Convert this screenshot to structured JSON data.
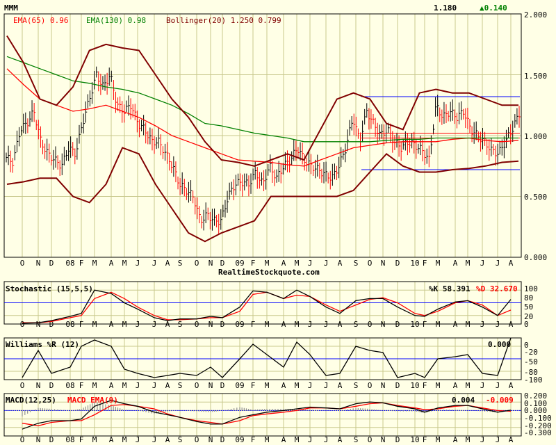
{
  "header": {
    "symbol": "MMM",
    "last_price": "1.180",
    "change": "▲0.140",
    "change_color": "#008000",
    "ema65_label": "EMA(65) 0.96",
    "ema130_label": "EMA(130) 0.98",
    "bollinger_label": "Bollinger(20) 1.250 0.799",
    "watermark": "RealtimeStockquote.com"
  },
  "colors": {
    "background": "#FFFFE6",
    "grid": "#C8C88C",
    "ema65": "#FF0000",
    "ema130": "#008000",
    "bollinger": "#800000",
    "reference": "#0000FF",
    "down_bar": "#FF0000",
    "up_bar": "#000000"
  },
  "months": [
    "O",
    "N",
    "D",
    "08",
    "F",
    "M",
    "A",
    "M",
    "J",
    "J",
    "A",
    "S",
    "O",
    "N",
    "D",
    "09",
    "F",
    "M",
    "A",
    "M",
    "J",
    "J",
    "A",
    "S",
    "O",
    "N",
    "D",
    "10",
    "F",
    "M",
    "A",
    "M",
    "J",
    "J",
    "A"
  ],
  "chart_data": [
    {
      "type": "line",
      "title": "MMM price",
      "ylabel": "",
      "ylim": [
        0,
        2
      ],
      "yticks": [
        "2.000",
        "1.500",
        "1.000",
        "0.500",
        "0.000"
      ],
      "close": [
        0.82,
        0.78,
        1.05,
        1.1,
        1.2,
        0.95,
        0.85,
        0.8,
        0.75,
        0.9,
        0.85,
        1.1,
        1.3,
        1.5,
        1.4,
        1.5,
        1.25,
        1.2,
        1.25,
        1.1,
        1.05,
        0.95,
        0.95,
        0.85,
        0.75,
        0.6,
        0.55,
        0.5,
        0.3,
        0.35,
        0.3,
        0.3,
        0.5,
        0.6,
        0.62,
        0.6,
        0.7,
        0.6,
        0.75,
        0.65,
        0.75,
        0.8,
        0.9,
        0.8,
        0.75,
        0.72,
        0.68,
        0.65,
        0.75,
        0.9,
        1.15,
        0.95,
        1.2,
        1.1,
        1.0,
        1.05,
        0.95,
        0.9,
        0.95,
        0.92,
        0.88,
        0.8,
        1.25,
        1.15,
        1.2,
        1.15,
        1.2,
        1.05,
        1.0,
        0.95,
        0.88,
        0.85,
        0.95,
        1.05,
        1.18
      ],
      "series": [
        {
          "name": "EMA(65)",
          "values": [
            1.55,
            1.42,
            1.3,
            1.25,
            1.2,
            1.22,
            1.25,
            1.2,
            1.15,
            1.08,
            1.0,
            0.95,
            0.9,
            0.85,
            0.8,
            0.79,
            0.78,
            0.76,
            0.75,
            0.8,
            0.85,
            0.9,
            0.92,
            0.94,
            0.95,
            0.95,
            0.95,
            0.97,
            0.98,
            0.96,
            0.95,
            0.96
          ]
        },
        {
          "name": "EMA(130)",
          "values": [
            1.65,
            1.6,
            1.55,
            1.5,
            1.45,
            1.43,
            1.4,
            1.38,
            1.35,
            1.3,
            1.25,
            1.18,
            1.1,
            1.08,
            1.05,
            1.02,
            1.0,
            0.98,
            0.95,
            0.95,
            0.95,
            0.95,
            0.95,
            0.96,
            0.97,
            0.97,
            0.98,
            0.98,
            0.98,
            0.98,
            0.98,
            0.98
          ]
        },
        {
          "name": "Bollinger Upper",
          "values": [
            1.82,
            1.6,
            1.3,
            1.25,
            1.4,
            1.7,
            1.75,
            1.72,
            1.7,
            1.5,
            1.3,
            1.15,
            0.95,
            0.8,
            0.78,
            0.75,
            0.8,
            0.85,
            0.8,
            1.05,
            1.3,
            1.35,
            1.3,
            1.1,
            1.05,
            1.35,
            1.38,
            1.35,
            1.35,
            1.3,
            1.25,
            1.25
          ]
        },
        {
          "name": "Bollinger Lower",
          "values": [
            0.6,
            0.62,
            0.65,
            0.65,
            0.5,
            0.45,
            0.6,
            0.9,
            0.85,
            0.6,
            0.4,
            0.2,
            0.13,
            0.2,
            0.25,
            0.3,
            0.5,
            0.5,
            0.5,
            0.5,
            0.5,
            0.55,
            0.7,
            0.85,
            0.75,
            0.7,
            0.7,
            0.72,
            0.73,
            0.75,
            0.78,
            0.79
          ]
        }
      ],
      "support_resistance": [
        1.32,
        1.02,
        0.98,
        0.72
      ]
    },
    {
      "type": "line",
      "title": "Stochastic (15,5,5)",
      "k_label": "%K 58.391",
      "d_label": "%D 32.670",
      "ylim": [
        0,
        100
      ],
      "yticks": [
        "100",
        "80",
        "50",
        "20",
        "0"
      ],
      "reference": 50,
      "series": [
        {
          "name": "%K",
          "values": [
            2,
            3,
            8,
            18,
            25,
            80,
            72,
            50,
            35,
            15,
            8,
            12,
            12,
            18,
            15,
            40,
            78,
            75,
            60,
            80,
            65,
            40,
            25,
            55,
            60,
            60,
            40,
            20,
            18,
            35,
            52,
            55,
            40,
            20,
            58
          ]
        },
        {
          "name": "%D",
          "values": [
            3,
            3,
            6,
            15,
            20,
            60,
            75,
            60,
            40,
            20,
            10,
            10,
            12,
            15,
            15,
            30,
            70,
            75,
            60,
            68,
            65,
            45,
            30,
            45,
            58,
            62,
            50,
            25,
            20,
            30,
            50,
            55,
            45,
            20,
            33
          ]
        }
      ]
    },
    {
      "type": "line",
      "title": "Williams %R (12)",
      "value_label": "0.000",
      "ylim": [
        -100,
        0
      ],
      "yticks": [
        "0",
        "-20",
        "-50",
        "-80",
        "-100"
      ],
      "reference": -50,
      "series": [
        {
          "name": "%R",
          "values": [
            -95,
            -30,
            -85,
            -70,
            -20,
            -5,
            -20,
            -75,
            -85,
            -95,
            -90,
            -85,
            -90,
            -70,
            -95,
            -50,
            -15,
            -40,
            -70,
            -10,
            -40,
            -90,
            -85,
            -20,
            -30,
            -35,
            -95,
            -85,
            -95,
            -50,
            -45,
            -40,
            -85,
            -90,
            0
          ]
        }
      ]
    },
    {
      "type": "line",
      "title": "MACD(12,25)",
      "signal_title": "MACD EMA(9)",
      "macd_label": "0.004",
      "signal_label": "-0.009",
      "ylim": [
        -0.3,
        0.2
      ],
      "yticks": [
        "0.200",
        "0.100",
        "0.000",
        "-0.100",
        "-0.200",
        "-0.300"
      ],
      "series": [
        {
          "name": "MACD",
          "values": [
            -0.22,
            -0.15,
            -0.12,
            -0.12,
            -0.1,
            0.05,
            0.12,
            0.08,
            0.05,
            -0.02,
            -0.05,
            -0.08,
            -0.13,
            -0.16,
            -0.16,
            -0.08,
            -0.05,
            -0.02,
            0.0,
            0.02,
            0.04,
            0.03,
            0.02,
            0.08,
            0.1,
            0.09,
            0.05,
            0.02,
            -0.02,
            0.03,
            0.06,
            0.06,
            0.02,
            -0.02,
            0.004
          ]
        },
        {
          "name": "MACD EMA(9)",
          "values": [
            -0.15,
            -0.18,
            -0.14,
            -0.12,
            -0.12,
            -0.05,
            0.06,
            0.07,
            0.05,
            0.02,
            -0.04,
            -0.08,
            -0.12,
            -0.14,
            -0.16,
            -0.12,
            -0.06,
            -0.04,
            -0.02,
            0.0,
            0.03,
            0.03,
            0.02,
            0.05,
            0.08,
            0.09,
            0.06,
            0.03,
            0.01,
            0.02,
            0.05,
            0.06,
            0.03,
            0.0,
            -0.009
          ]
        }
      ]
    }
  ]
}
